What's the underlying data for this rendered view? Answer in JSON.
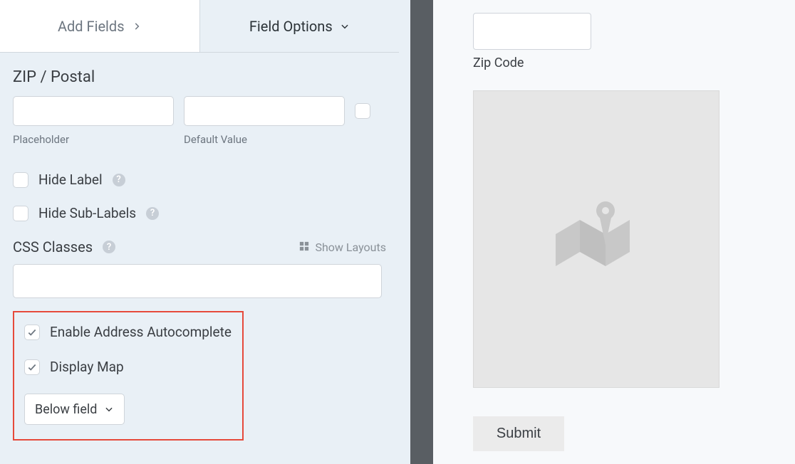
{
  "tabs": {
    "add_fields": "Add Fields",
    "field_options": "Field Options"
  },
  "zip_section": {
    "title": "ZIP / Postal",
    "placeholder_label": "Placeholder",
    "default_label": "Default Value",
    "placeholder_value": "",
    "default_value": ""
  },
  "options": {
    "hide_label": "Hide Label",
    "hide_sublabels": "Hide Sub-Labels"
  },
  "css": {
    "title": "CSS Classes",
    "show_layouts": "Show Layouts",
    "value": ""
  },
  "highlight": {
    "enable_autocomplete": "Enable Address Autocomplete",
    "display_map": "Display Map",
    "dropdown_value": "Below field"
  },
  "preview": {
    "zip_label": "Zip Code",
    "submit": "Submit"
  }
}
